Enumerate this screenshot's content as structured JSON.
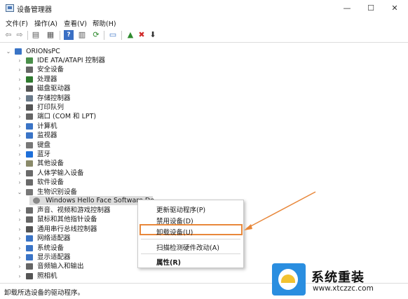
{
  "window": {
    "title": "设备管理器",
    "minimize": "—",
    "maximize": "☐",
    "close": "✕"
  },
  "menus": [
    {
      "label": "文件(F)"
    },
    {
      "label": "操作(A)"
    },
    {
      "label": "查看(V)"
    },
    {
      "label": "帮助(H)"
    }
  ],
  "toolbar": {
    "back_icon": "⇦",
    "forward_icon": "⇨",
    "properties_icon": "▤",
    "view_icon": "▦",
    "help_icon": "?",
    "view2_icon": "▥",
    "scan_icon": "⟳",
    "monitor_icon": "▭",
    "enable_icon": "▲",
    "uninstall_icon": "✖",
    "update_icon": "⬇"
  },
  "tree": {
    "root": "ORIONsPC",
    "categories": [
      {
        "label": "IDE ATA/ATAPI 控制器",
        "color": "#4a8f4a"
      },
      {
        "label": "安全设备",
        "color": "#666666"
      },
      {
        "label": "处理器",
        "color": "#2f7a2f"
      },
      {
        "label": "磁盘驱动器",
        "color": "#555555"
      },
      {
        "label": "存储控制器",
        "color": "#6a7a8a"
      },
      {
        "label": "打印队列",
        "color": "#555555"
      },
      {
        "label": "端口 (COM 和 LPT)",
        "color": "#666666"
      },
      {
        "label": "计算机",
        "color": "#3a74c6"
      },
      {
        "label": "监视器",
        "color": "#3a74c6"
      },
      {
        "label": "键盘",
        "color": "#777777"
      },
      {
        "label": "蓝牙",
        "color": "#1e6fd9"
      },
      {
        "label": "其他设备",
        "color": "#8a8a6a"
      },
      {
        "label": "人体学输入设备",
        "color": "#6a6a6a"
      },
      {
        "label": "软件设备",
        "color": "#6a6a6a"
      },
      {
        "label": "生物识别设备",
        "color": "#777777"
      }
    ],
    "child": "Windows Hello Face Software De",
    "after": [
      {
        "label": "声音、视频和游戏控制器",
        "color": "#6a6a6a"
      },
      {
        "label": "鼠标和其他指针设备",
        "color": "#666666"
      },
      {
        "label": "通用串行总线控制器",
        "color": "#555555"
      },
      {
        "label": "网络适配器",
        "color": "#3a74c6"
      },
      {
        "label": "系统设备",
        "color": "#3a74c6"
      },
      {
        "label": "显示适配器",
        "color": "#3a74c6"
      },
      {
        "label": "音频输入和输出",
        "color": "#666666"
      },
      {
        "label": "照相机",
        "color": "#555555"
      }
    ]
  },
  "context_menu": {
    "update_driver": "更新驱动程序(P)",
    "disable_device": "禁用设备(D)",
    "uninstall_device": "卸载设备(U)",
    "scan_changes": "扫描检测硬件改动(A)",
    "properties": "属性(R)"
  },
  "status": "卸载所选设备的驱动程序。",
  "watermark": {
    "title": "系统重装",
    "url": "www.xtczzc.com"
  },
  "colors": {
    "highlight": "#e8873a",
    "accent": "#2a8ee0"
  }
}
